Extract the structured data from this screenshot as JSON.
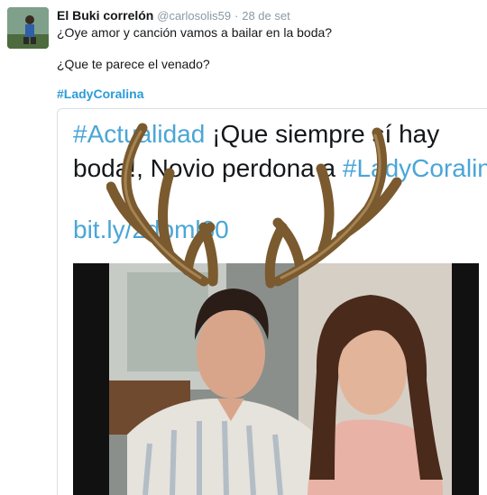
{
  "tweet": {
    "author_name": "El Buki correlón",
    "handle": "@carlosolis59",
    "separator": "·",
    "date": "28 de set",
    "line1": "¿Oye amor y canción vamos a bailar en la boda?",
    "line2": "¿Que te parece el venado?",
    "hashtag": "#LadyCoralina"
  },
  "quoted": {
    "hashtag1": "#Actualidad",
    "text1": " ¡Que siempre sí hay",
    "text2": "boda!, Novio perdona a ",
    "hashtag2": "#LadyCoralina",
    "link": "bit.ly/2dpml60"
  },
  "colors": {
    "link": "#2b9bd8",
    "muted": "#8899a6",
    "antler": "#7a5a2e"
  },
  "icons": [
    "avatar",
    "antlers-overlay",
    "couple-photo"
  ]
}
